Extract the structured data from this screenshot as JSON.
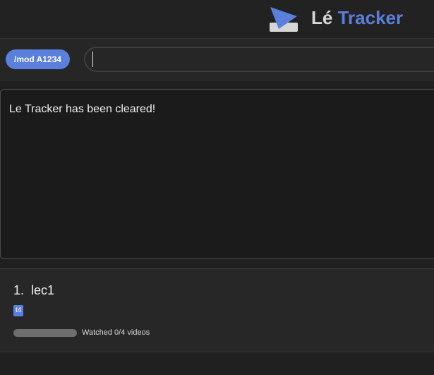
{
  "header": {
    "title_part1": "Lé",
    "title_part2": "Tracker",
    "logo_icon": "play-triangle-logo-icon"
  },
  "command_bar": {
    "mode_label": "/mod A1234",
    "input_value": "",
    "input_placeholder": ""
  },
  "result": {
    "message": "Le Tracker has been cleared!"
  },
  "list": {
    "items": [
      {
        "index": "1.",
        "name": "lec1",
        "tag": "t4",
        "progress_fraction": 0,
        "progress_text": "Watched 0/4 videos"
      }
    ]
  },
  "colors": {
    "accent": "#5b7fdc",
    "background": "#202020",
    "panel": "#272727",
    "result_bg": "#1b1b1b",
    "text": "#f0f0f0"
  }
}
